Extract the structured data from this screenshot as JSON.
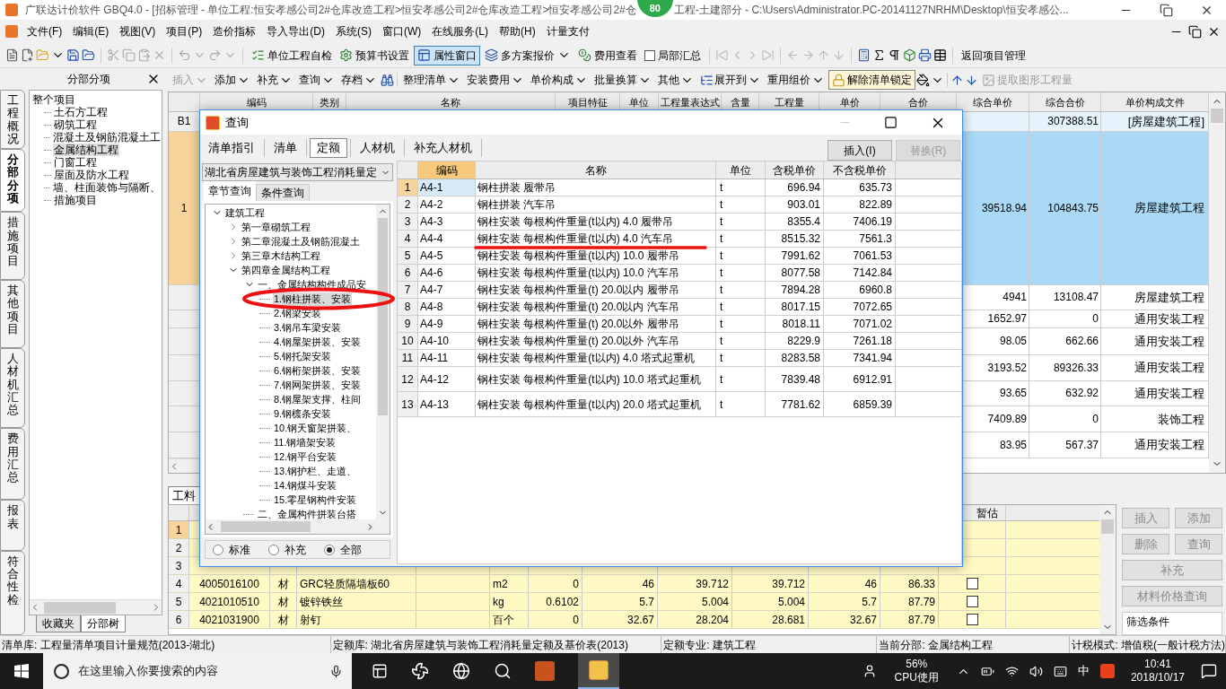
{
  "title_bar": {
    "title_start": "广联达计价软件 GBQ4.0 - [招标管理 - 单位工程:恒安孝感公司2#仓库改造工程>恒安孝感公司2#仓库改造工程>恒安孝感公司2#仓",
    "badge": "80",
    "title_end": "工程-土建部分 - C:\\Users\\Administrator.PC-20141127NRHM\\Desktop\\恒安孝感公..."
  },
  "menu": [
    "文件(F)",
    "编辑(E)",
    "视图(V)",
    "项目(P)",
    "造价指标",
    "导入导出(D)",
    "系统(S)",
    "窗口(W)",
    "在线服务(L)",
    "帮助(H)",
    "计量支付"
  ],
  "toolbar": [
    {
      "kind": "button",
      "label": "单位工程自检"
    },
    {
      "kind": "button",
      "label": "预算书设置"
    },
    {
      "kind": "toggle",
      "label": "属性窗口",
      "selected": true
    },
    {
      "kind": "dropdown",
      "label": "多方案报价"
    },
    {
      "kind": "button",
      "label": "费用查看"
    },
    {
      "kind": "checkbox",
      "label": "局部汇总",
      "checked": false
    },
    {
      "kind": "button",
      "label": "返回项目管理"
    }
  ],
  "edit_toolbar": [
    {
      "kind": "dropdown",
      "label": "插入",
      "disabled": true
    },
    {
      "kind": "dropdown",
      "label": "添加",
      "disabled": false
    },
    {
      "kind": "dropdown",
      "label": "补充",
      "disabled": false
    },
    {
      "kind": "dropdown",
      "label": "查询",
      "disabled": false
    },
    {
      "kind": "dropdown",
      "label": "存档",
      "disabled": false
    },
    {
      "kind": "dropdown",
      "label": "整理清单",
      "disabled": false
    },
    {
      "kind": "dropdown",
      "label": "安装费用",
      "disabled": false
    },
    {
      "kind": "dropdown",
      "label": "单价构成",
      "disabled": false
    },
    {
      "kind": "dropdown",
      "label": "批量换算",
      "disabled": false
    },
    {
      "kind": "dropdown",
      "label": "其他",
      "disabled": false
    },
    {
      "kind": "dropdown",
      "label": "展开到",
      "disabled": false
    },
    {
      "kind": "dropdown",
      "label": "重用组价",
      "disabled": false
    },
    {
      "kind": "button",
      "label": "解除清单锁定",
      "disabled": false
    },
    {
      "kind": "button",
      "label": "提取图形工程量",
      "disabled": true
    }
  ],
  "side_tabs": [
    {
      "label": "工程概况",
      "selected": false
    },
    {
      "label": "分部分项",
      "selected": true
    },
    {
      "label": "措施项目",
      "selected": false
    },
    {
      "label": "其他项目",
      "selected": false
    },
    {
      "label": "人材机汇总",
      "selected": false
    },
    {
      "label": "费用汇总",
      "selected": false
    },
    {
      "label": "报表",
      "selected": false
    },
    {
      "label": "符合性检",
      "selected": false
    }
  ],
  "left_panel": {
    "title": "分部分项",
    "tree": {
      "label": "整个项目",
      "selected": false,
      "children": [
        {
          "label": "土石方工程",
          "selected": false
        },
        {
          "label": "砌筑工程",
          "selected": false
        },
        {
          "label": "混凝土及钢筋混凝土工",
          "selected": false
        },
        {
          "label": "金属结构工程",
          "selected": true
        },
        {
          "label": "门窗工程",
          "selected": false
        },
        {
          "label": "屋面及防水工程",
          "selected": false
        },
        {
          "label": "墙、柱面装饰与隔断、",
          "selected": false
        },
        {
          "label": "措施项目",
          "selected": false
        }
      ]
    },
    "bottom_tabs": [
      {
        "label": "收藏夹",
        "selected": false
      },
      {
        "label": "分部树",
        "selected": true
      }
    ]
  },
  "grid": {
    "columns": [
      "编码",
      "类别",
      "名称",
      "项目特征",
      "单位",
      "工程量表达式",
      "含量",
      "工程量",
      "单价",
      "合价",
      "综合单价",
      "综合合价",
      "单价构成文件"
    ],
    "rows": [
      {
        "number": "B1",
        "kind": "section",
        "selected": false,
        "total": "307388.51",
        "price_file": "[房屋建筑工程]"
      },
      {
        "number": "1",
        "kind": "item",
        "selected": true,
        "unit_price": "39518.94",
        "total": "104843.75",
        "price_file": "房屋建筑工程"
      },
      {
        "kind": "item",
        "selected": false,
        "unit_price": "4941",
        "total": "13108.47",
        "price_file": "房屋建筑工程"
      },
      {
        "kind": "item",
        "selected": false,
        "unit_price": "1652.97",
        "total": "0",
        "price_file": "通用安装工程"
      },
      {
        "kind": "item",
        "selected": false,
        "unit_price": "98.05",
        "total": "662.66",
        "price_file": "通用安装工程"
      },
      {
        "kind": "item",
        "selected": false,
        "unit_price": "3193.52",
        "total": "89326.33",
        "price_file": "通用安装工程"
      },
      {
        "kind": "item",
        "selected": false,
        "unit_price": "93.65",
        "total": "632.92",
        "price_file": "通用安装工程"
      },
      {
        "kind": "item",
        "selected": false,
        "unit_price": "7409.89",
        "total": "0",
        "price_file": "装饰工程"
      },
      {
        "kind": "item",
        "selected": false,
        "unit_price": "83.95",
        "total": "567.37",
        "price_file": "通用安装工程"
      }
    ]
  },
  "detail_tab": "工料",
  "detail_table": {
    "columns": [
      "暂估"
    ],
    "rows": [
      {
        "number": "1",
        "selected": true
      },
      {
        "number": "2",
        "selected": false
      },
      {
        "number": "3",
        "selected": false
      },
      {
        "number": "4",
        "selected": false,
        "code": "4005016100",
        "type": "材",
        "name": "GRC轻质隔墙板60",
        "unit": "m2",
        "values": [
          "0",
          "46",
          "39.712",
          "39.712",
          "46",
          "86.33"
        ],
        "provisional": false
      },
      {
        "number": "5",
        "selected": false,
        "code": "4021010510",
        "type": "材",
        "name": "镀锌铁丝",
        "unit": "kg",
        "values": [
          "0.6102",
          "5.7",
          "5.004",
          "5.004",
          "5.7",
          "87.79"
        ],
        "provisional": false
      },
      {
        "number": "6",
        "selected": false,
        "code": "4021031900",
        "type": "材",
        "name": "射钉",
        "unit": "百个",
        "values": [
          "0",
          "32.67",
          "28.204",
          "28.681",
          "32.67",
          "87.79"
        ],
        "provisional": false
      }
    ]
  },
  "side_buttons": [
    {
      "label": "插入",
      "disabled": true
    },
    {
      "label": "添加",
      "disabled": true
    },
    {
      "label": "删除",
      "disabled": true
    },
    {
      "label": "查询",
      "disabled": true
    },
    {
      "label": "补充",
      "disabled": true
    },
    {
      "label": "材料价格查询",
      "disabled": true
    }
  ],
  "filter_label": "筛选条件",
  "query_dialog": {
    "title": "查询",
    "tabs": [
      {
        "label": "清单指引",
        "selected": false
      },
      {
        "label": "清单",
        "selected": false
      },
      {
        "label": "定额",
        "selected": true
      },
      {
        "label": "人材机",
        "selected": false
      },
      {
        "label": "补充人材机",
        "selected": false
      }
    ],
    "buttons": [
      {
        "label": "插入(I)",
        "disabled": false
      },
      {
        "label": "替换(R)",
        "disabled": true
      }
    ],
    "library": "湖北省房屋建筑与装饰工程消耗量定",
    "search_tabs": [
      {
        "label": "章节查询",
        "selected": true
      },
      {
        "label": "条件查询",
        "selected": false
      }
    ],
    "tree": [
      {
        "label": "建筑工程",
        "expanded": true,
        "selected": false,
        "children": [
          {
            "label": "第一章砌筑工程",
            "expanded": false,
            "selected": false
          },
          {
            "label": "第二章混凝土及钢筋混凝土",
            "expanded": false,
            "selected": false
          },
          {
            "label": "第三章木结构工程",
            "expanded": false,
            "selected": false
          },
          {
            "label": "第四章金属结构工程",
            "expanded": true,
            "selected": false,
            "children": [
              {
                "label": "一、金属结构构件成品安",
                "expanded": true,
                "selected": false,
                "children": [
                  {
                    "label": "1.钢柱拼装、安装",
                    "selected": true
                  },
                  {
                    "label": "2.钢梁安装",
                    "selected": false
                  },
                  {
                    "label": "3.钢吊车梁安装",
                    "selected": false
                  },
                  {
                    "label": "4.钢屋架拼装、安装",
                    "selected": false
                  },
                  {
                    "label": "5.钢托架安装",
                    "selected": false
                  },
                  {
                    "label": "6.钢桁架拼装、安装",
                    "selected": false
                  },
                  {
                    "label": "7.钢网架拼装、安装",
                    "selected": false
                  },
                  {
                    "label": "8.钢屋架支撑、柱间",
                    "selected": false
                  },
                  {
                    "label": "9.钢檩条安装",
                    "selected": false
                  },
                  {
                    "label": "10.钢天窗架拼装、",
                    "selected": false
                  },
                  {
                    "label": "11.钢墙架安装",
                    "selected": false
                  },
                  {
                    "label": "12.钢平台安装",
                    "selected": false
                  },
                  {
                    "label": "13.钢护栏、走道、",
                    "selected": false
                  },
                  {
                    "label": "14.钢煤斗安装",
                    "selected": false
                  },
                  {
                    "label": "15.零星钢构件安装",
                    "selected": false
                  }
                ]
              },
              {
                "label": "二、金属构件拼装台搭",
                "selected": false
              }
            ]
          }
        ]
      }
    ],
    "filters": [
      {
        "label": "标准",
        "selected": false
      },
      {
        "label": "补充",
        "selected": false
      },
      {
        "label": "全部",
        "selected": true
      }
    ],
    "table": {
      "columns": [
        "编码",
        "名称",
        "单位",
        "含税单价",
        "不含税单价"
      ],
      "rows": [
        {
          "number": "1",
          "code": "A4-1",
          "name": "钢柱拼装 履带吊",
          "unit": "t",
          "tax_price": "696.94",
          "price": "635.73",
          "selected": true
        },
        {
          "number": "2",
          "code": "A4-2",
          "name": "钢柱拼装 汽车吊",
          "unit": "t",
          "tax_price": "903.01",
          "price": "822.89",
          "selected": false
        },
        {
          "number": "3",
          "code": "A4-3",
          "name": "钢柱安装 每根构件重量(t以内) 4.0 履带吊",
          "unit": "t",
          "tax_price": "8355.4",
          "price": "7406.19",
          "selected": false
        },
        {
          "number": "4",
          "code": "A4-4",
          "name": "钢柱安装 每根构件重量(t以内) 4.0 汽车吊",
          "unit": "t",
          "tax_price": "8515.32",
          "price": "7561.3",
          "selected": false
        },
        {
          "number": "5",
          "code": "A4-5",
          "name": "钢柱安装 每根构件重量(t以内) 10.0 履带吊",
          "unit": "t",
          "tax_price": "7991.62",
          "price": "7061.53",
          "selected": false
        },
        {
          "number": "6",
          "code": "A4-6",
          "name": "钢柱安装 每根构件重量(t以内) 10.0 汽车吊",
          "unit": "t",
          "tax_price": "8077.58",
          "price": "7142.84",
          "selected": false
        },
        {
          "number": "7",
          "code": "A4-7",
          "name": "钢柱安装 每根构件重量(t) 20.0以内 履带吊",
          "unit": "t",
          "tax_price": "7894.28",
          "price": "6960.8",
          "selected": false
        },
        {
          "number": "8",
          "code": "A4-8",
          "name": "钢柱安装 每根构件重量(t) 20.0以内 汽车吊",
          "unit": "t",
          "tax_price": "8017.15",
          "price": "7072.65",
          "selected": false
        },
        {
          "number": "9",
          "code": "A4-9",
          "name": "钢柱安装 每根构件重量(t) 20.0以外 履带吊",
          "unit": "t",
          "tax_price": "8018.11",
          "price": "7071.02",
          "selected": false
        },
        {
          "number": "10",
          "code": "A4-10",
          "name": "钢柱安装 每根构件重量(t) 20.0以外 汽车吊",
          "unit": "t",
          "tax_price": "8229.9",
          "price": "7261.18",
          "selected": false
        },
        {
          "number": "11",
          "code": "A4-11",
          "name": "钢柱安装 每根构件重量(t以内) 4.0 塔式起重机",
          "unit": "t",
          "tax_price": "8283.58",
          "price": "7341.94",
          "selected": false
        },
        {
          "number": "12",
          "code": "A4-12",
          "name": "钢柱安装 每根构件重量(t以内) 10.0 塔式起重机",
          "unit": "t",
          "tax_price": "7839.48",
          "price": "6912.91",
          "selected": false
        },
        {
          "number": "13",
          "code": "A4-13",
          "name": "钢柱安装 每根构件重量(t以内) 20.0 塔式起重机",
          "unit": "t",
          "tax_price": "7781.62",
          "price": "6859.39",
          "selected": false
        }
      ]
    }
  },
  "status_bar": [
    "清单库: 工程量清单项目计量规范(2013-湖北)",
    "定额库: 湖北省房屋建筑与装饰工程消耗量定额及基价表(2013)",
    "定额专业: 建筑工程",
    "当前分部: 金属结构工程",
    "计税模式: 增值税(一般计税方法)"
  ],
  "taskbar": {
    "search_placeholder": "在这里输入你要搜索的内容",
    "cpu": "56%",
    "cpu_label": "CPU使用",
    "ime": "中",
    "time": "10:41",
    "date": "2018/10/17"
  }
}
